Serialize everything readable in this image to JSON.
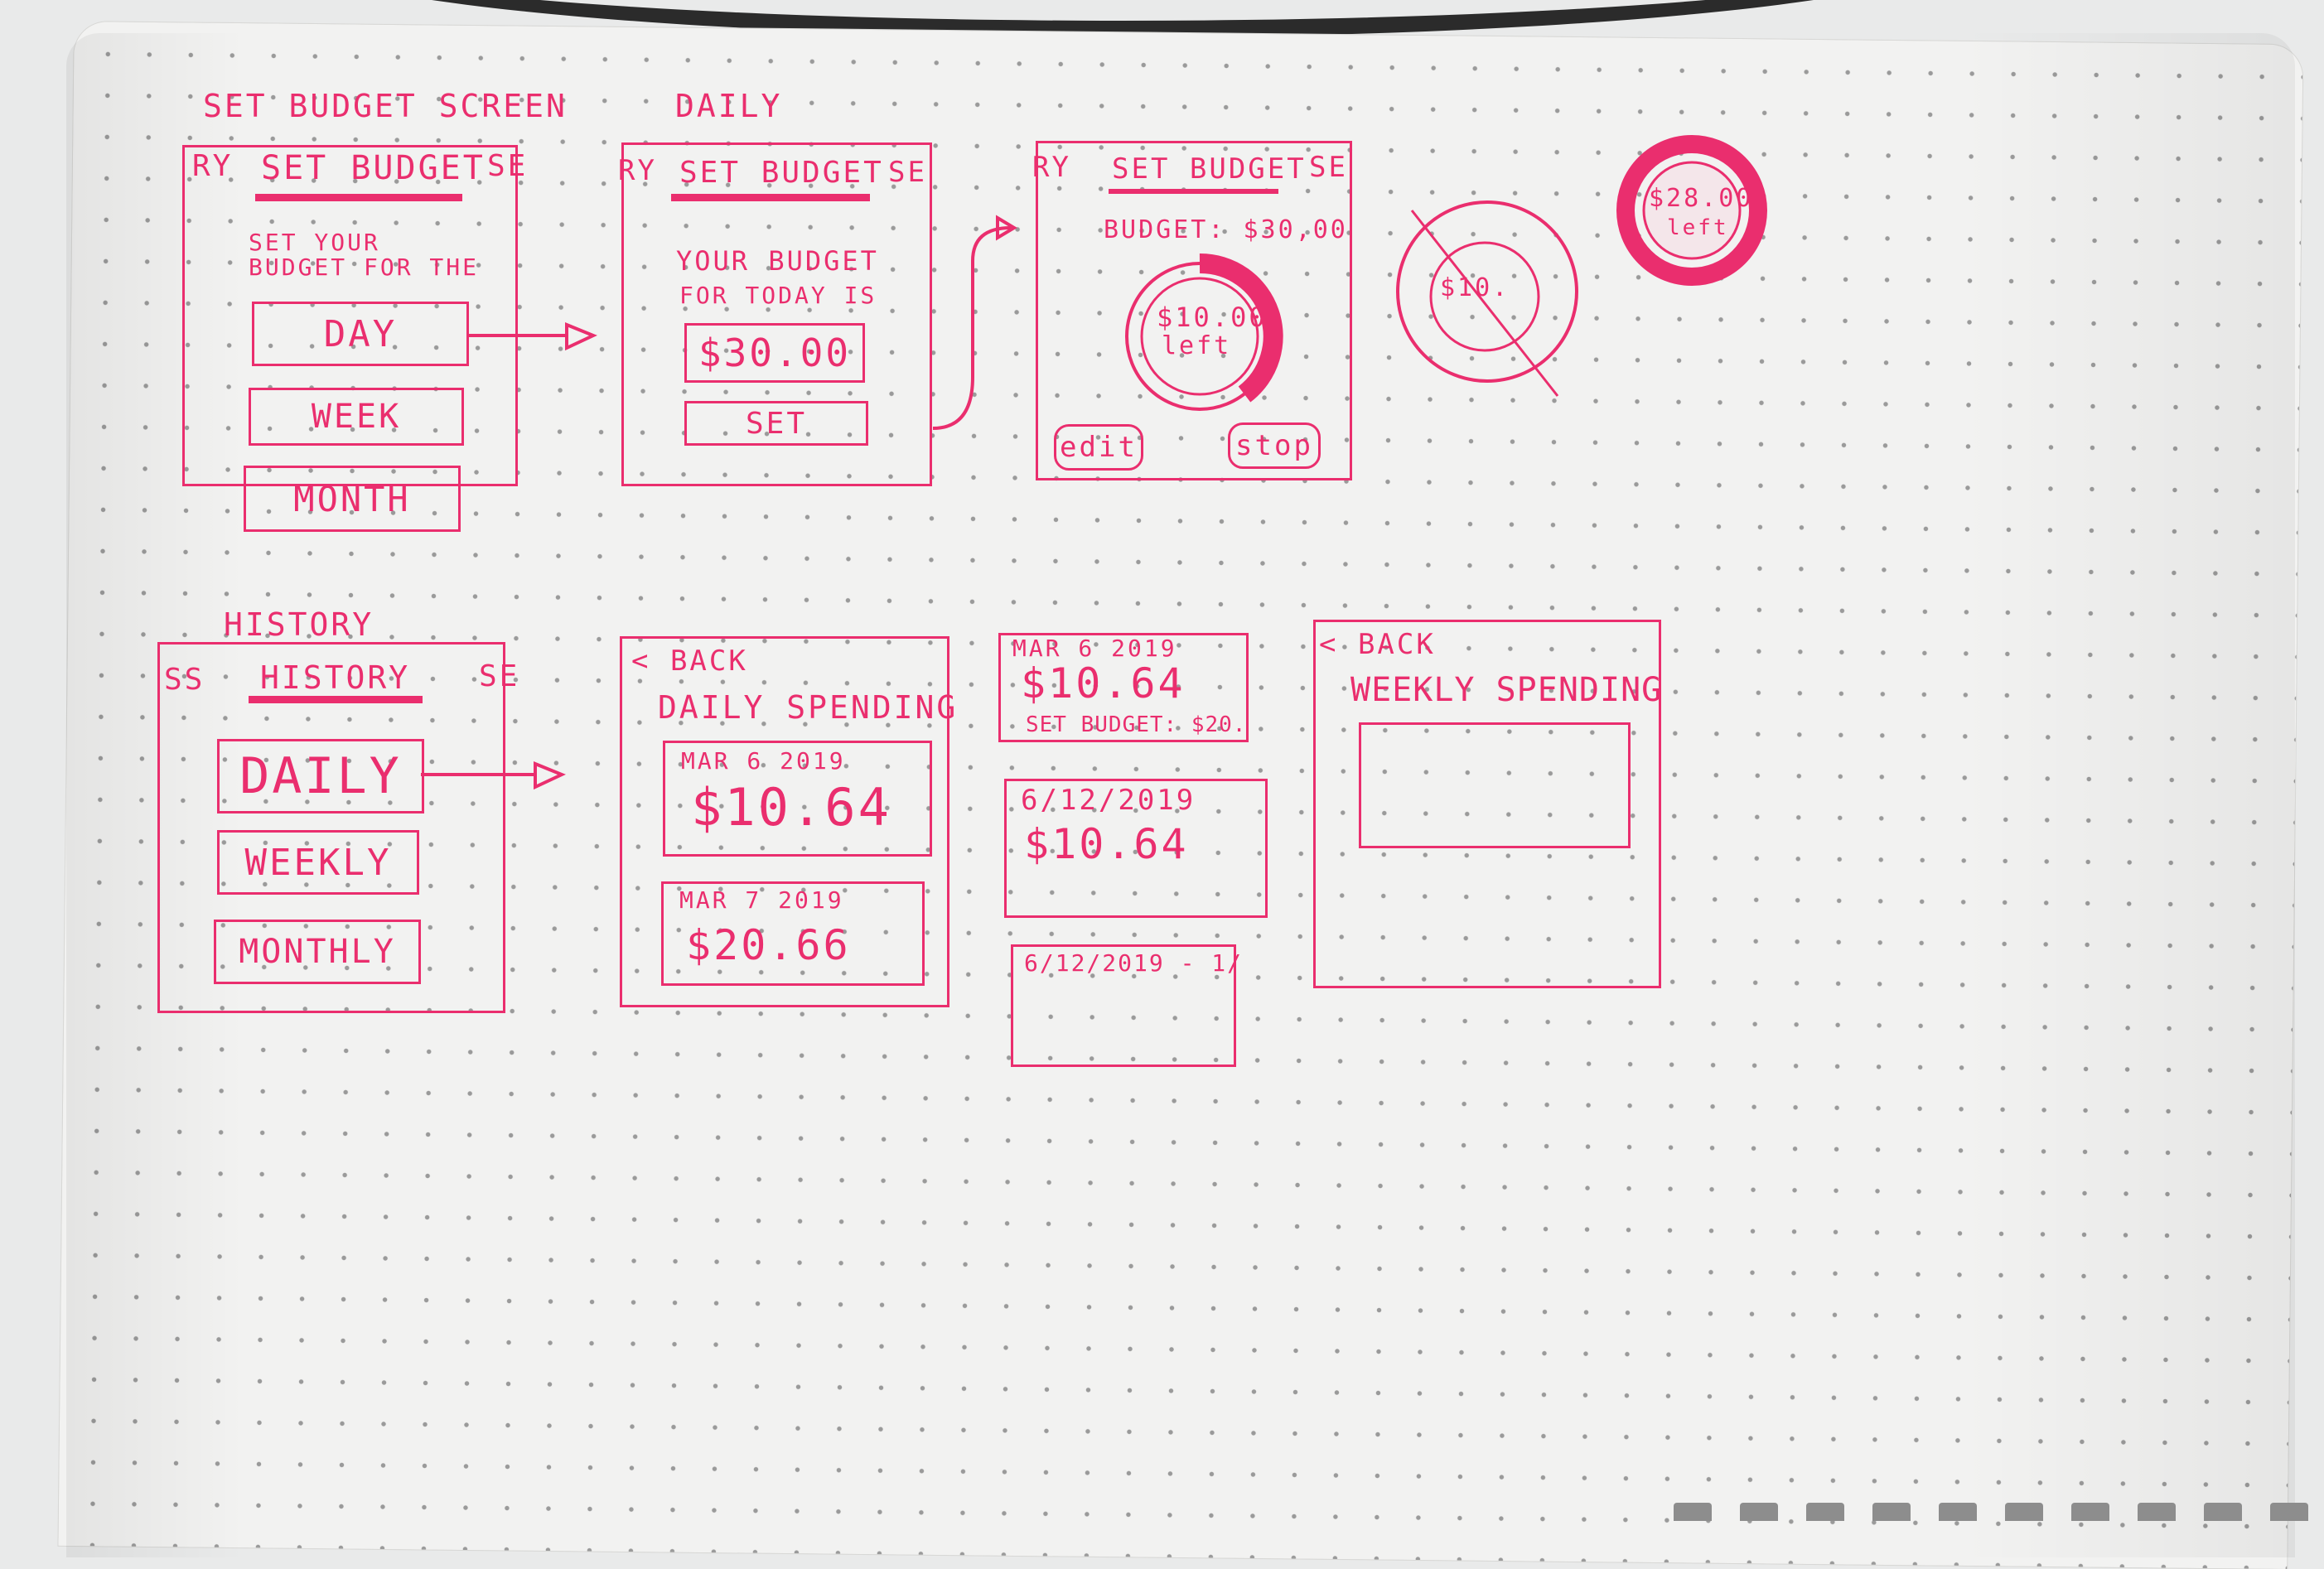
{
  "section_labels": {
    "set_budget_screen": "SET BUDGET SCREEN",
    "daily": "DAILY",
    "history": "HISTORY"
  },
  "screen1": {
    "tab_left": "RY",
    "tab_title": "SET BUDGET",
    "tab_right": "SE",
    "prompt_line1": "SET YOUR",
    "prompt_line2": "BUDGET FOR THE",
    "day": "DAY",
    "week": "WEEK",
    "month": "MONTH"
  },
  "screen2": {
    "tab_left": "RY",
    "tab_title": "SET BUDGET",
    "tab_right": "SE",
    "text_line1": "YOUR BUDGET",
    "text_line2": "FOR TODAY IS",
    "amount": "$30.00",
    "set": "SET"
  },
  "screen3": {
    "tab_left": "RY",
    "tab_title": "SET BUDGET",
    "tab_right": "SE",
    "budget_line": "BUDGET: $30,00",
    "ring_amount": "$10.00",
    "ring_left": "left",
    "edit": "edit",
    "stop": "stop"
  },
  "scratch": {
    "crossed_amount": "$10.",
    "ring_amount": "$28.00",
    "ring_left": "left"
  },
  "history_screen": {
    "tab_left": "SS",
    "tab_title": "HISTORY",
    "tab_right": "SE",
    "daily": "DAILY",
    "weekly": "WEEKLY",
    "monthly": "MONTHLY"
  },
  "daily_spending": {
    "back": "< BACK",
    "title": "DAILY SPENDING",
    "cards": [
      {
        "date": "MAR 6 2019",
        "amount": "$10.64"
      },
      {
        "date": "MAR 7 2019",
        "amount": "$20.66"
      }
    ]
  },
  "cards_alt": {
    "card1_date": "MAR 6 2019",
    "card1_amount": "$10.64",
    "card1_budget": "SET BUDGET: $20.",
    "card2_date": "6/12/2019",
    "card2_amount": "$10.64",
    "card3_date": "6/12/2019 - 1/"
  },
  "weekly_spending": {
    "back": "< BACK",
    "title": "WEEKLY SPENDING"
  },
  "ink_color": "#ea2e6e"
}
